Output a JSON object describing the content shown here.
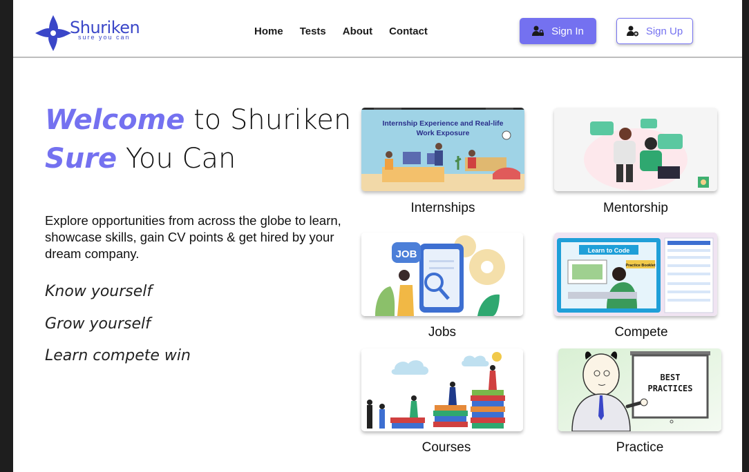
{
  "brand": {
    "name": "Shuriken",
    "tagline": "sure you can",
    "color": "#3a46c8"
  },
  "nav": {
    "items": [
      "Home",
      "Tests",
      "About",
      "Contact"
    ]
  },
  "auth": {
    "signin_label": "Sign In",
    "signup_label": "Sign Up",
    "accent": "#7471f0"
  },
  "hero": {
    "line1_accent": "Welcome",
    "line1_rest": " to Shuriken",
    "line2_accent": "Sure",
    "line2_rest": " You Can",
    "description": "Explore opportunities from across the globe to learn, showcase skills, gain CV points & get hired by your dream company.",
    "mottos": [
      "Know yourself",
      "Grow yourself",
      "Learn compete win"
    ]
  },
  "cards": [
    {
      "label": "Internships",
      "image_text": [
        "Internship Experience and Real-life",
        "Work Exposure"
      ]
    },
    {
      "label": "Mentorship"
    },
    {
      "label": "Jobs",
      "image_text": [
        "JOB"
      ]
    },
    {
      "label": "Compete",
      "image_text": [
        "Learn to Code",
        "Practice Booklet"
      ]
    },
    {
      "label": "Courses"
    },
    {
      "label": "Practice",
      "image_text": [
        "BEST",
        "PRACTICES"
      ]
    }
  ]
}
